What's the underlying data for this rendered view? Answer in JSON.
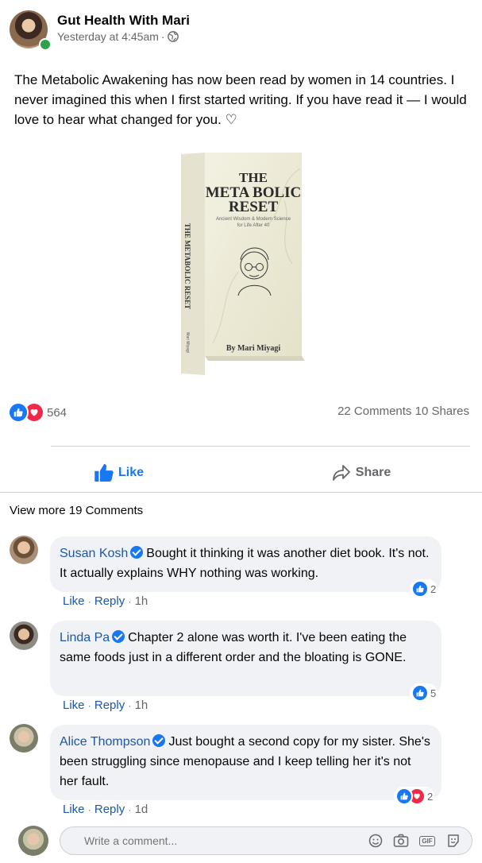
{
  "post": {
    "author": "Gut Health With Mari",
    "timestamp": "Yesterday at 4:45am",
    "separator": "·",
    "privacy_icon": "globe-icon",
    "text": "The Metabolic Awakening has now been read by women in 14 countries. I never imagined this when I first started writing. If you have read it — I would love to hear what changed for you. ♡",
    "book": {
      "title_line1": "THE",
      "title_line2": "META BOLIC",
      "title_line3": "RESET",
      "subtitle_line1": "Ancient Wisdom & Modern Science",
      "subtitle_line2": "for Life After 40",
      "byline": "By Mari Miyagi",
      "spine_title": "THE METABOLIC RESET",
      "spine_author": "Mari Miyagi"
    },
    "reaction_count": "564",
    "comments_count": "22 Comments",
    "shares_count": "10 Shares"
  },
  "actions": {
    "like_label": "Like",
    "share_label": "Share"
  },
  "view_more": "View more 19 Comments",
  "comments": [
    {
      "author": "Susan Kosh",
      "text": "Bought it thinking it was another diet book. It's not. It actually explains WHY nothing was working.",
      "reaction_count": "2",
      "like": "Like",
      "reply": "Reply",
      "time": "1h"
    },
    {
      "author": "Linda Pa",
      "text": "Chapter 2 alone was worth it. I've been eating the same foods just in a different order and the bloating is GONE.",
      "reaction_count": "5",
      "like": "Like",
      "reply": "Reply",
      "time": "1h"
    },
    {
      "author": "Alice Thompson",
      "text": "Just bought a second copy for my sister. She's been struggling since menopause and I keep telling her it's not her fault.",
      "reaction_count": "2",
      "like": "Like",
      "reply": "Reply",
      "time": "1d"
    }
  ],
  "composer": {
    "placeholder": "Write a comment...",
    "gif_label": "GIF"
  },
  "colors": {
    "facebook_blue": "#1877f2",
    "link_blue": "#1d57a8",
    "love_red": "#f0284a",
    "muted_gray": "#65676b",
    "bubble_bg": "#f0f2f5"
  }
}
